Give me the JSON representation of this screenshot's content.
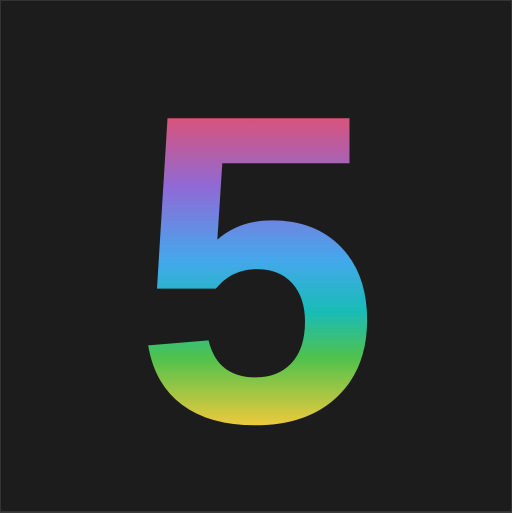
{
  "digit": "5",
  "colors": {
    "background": "#1c1c1c",
    "border": "#333333",
    "gradient": [
      "#ef4c5f",
      "#8f6ad6",
      "#45a7ec",
      "#19bcb7",
      "#4fc24d",
      "#e9c93d"
    ]
  }
}
